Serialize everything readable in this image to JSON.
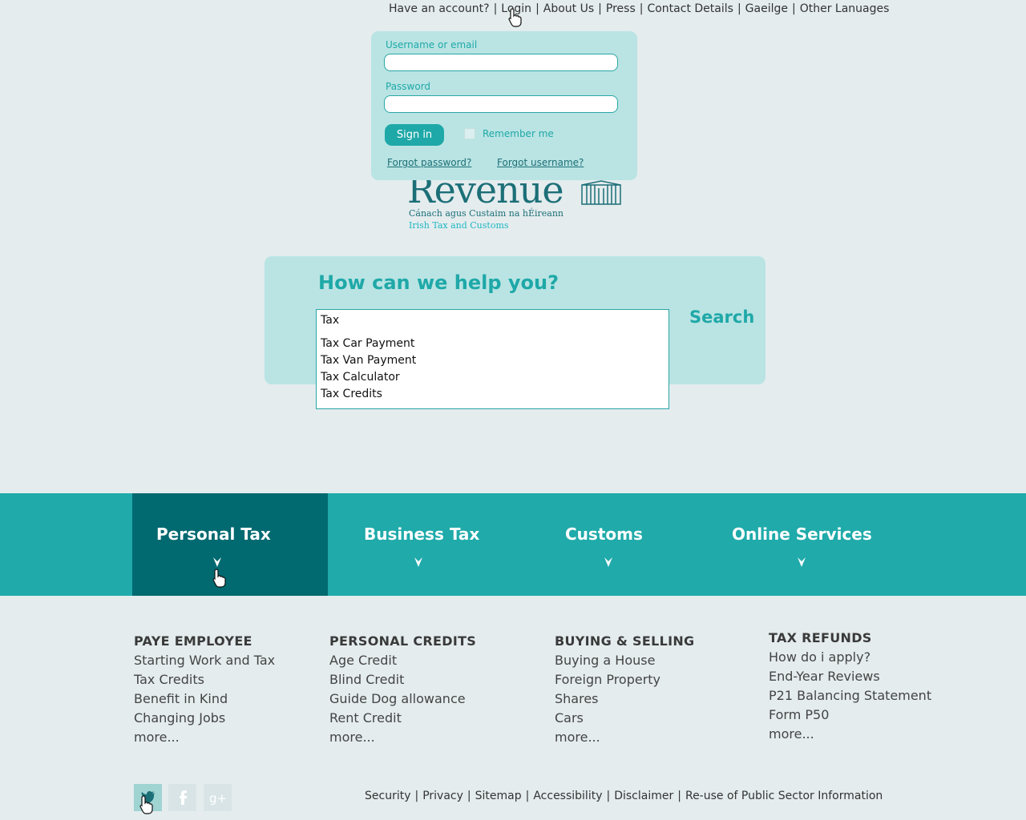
{
  "topnav": {
    "items": [
      "Have an account?",
      "Login",
      "About Us",
      "Press",
      "Contact Details",
      "Gaeilge",
      "Other Lanuages"
    ]
  },
  "login": {
    "username_label": "Username or email",
    "username_value": "",
    "password_label": "Password",
    "password_value": "",
    "signin_label": "Sign in",
    "remember_label": "Remember me",
    "forgot_password": "Forgot password?",
    "forgot_username": "Forgot username?"
  },
  "logo": {
    "word": "Revenue",
    "sub_irish": "Cánach agus Custaim na hÉireann",
    "sub_english": "Irish Tax and Customs"
  },
  "search": {
    "title": "How can we help you?",
    "value": "Tax",
    "button": "Search",
    "suggestions": [
      "Tax Car Payment",
      "Tax Van Payment",
      "Tax Calculator",
      "Tax Credits"
    ]
  },
  "categories": [
    "Personal Tax",
    "Business Tax",
    "Customs",
    "Online Services"
  ],
  "columns": [
    {
      "heading": "PAYE EMPLOYEE",
      "links": [
        "Starting Work and Tax",
        "Tax Credits",
        "Benefit in Kind",
        "Changing Jobs",
        "more..."
      ]
    },
    {
      "heading": "PERSONAL CREDITS",
      "links": [
        "Age Credit",
        "Blind Credit",
        "Guide Dog allowance",
        "Rent Credit",
        "more..."
      ]
    },
    {
      "heading": "BUYING & SELLING",
      "links": [
        "Buying a House",
        "Foreign Property",
        "Shares",
        "Cars",
        "more..."
      ]
    },
    {
      "heading": "TAX REFUNDS",
      "links": [
        "How do i apply?",
        "End-Year Reviews",
        "P21 Balancing Statement",
        "Form P50",
        "more..."
      ]
    }
  ],
  "social": [
    "twitter-icon",
    "facebook-icon",
    "google-plus-icon"
  ],
  "footer": {
    "links": [
      "Security",
      "Privacy",
      "Sitemap",
      "Accessibility",
      "Disclaimer",
      "Re-use of Public Sector Information"
    ]
  },
  "colors": {
    "teal": "#20aaaa",
    "dark_teal": "#006a70",
    "panel": "#b9e4e3",
    "background": "#e4ecee"
  }
}
